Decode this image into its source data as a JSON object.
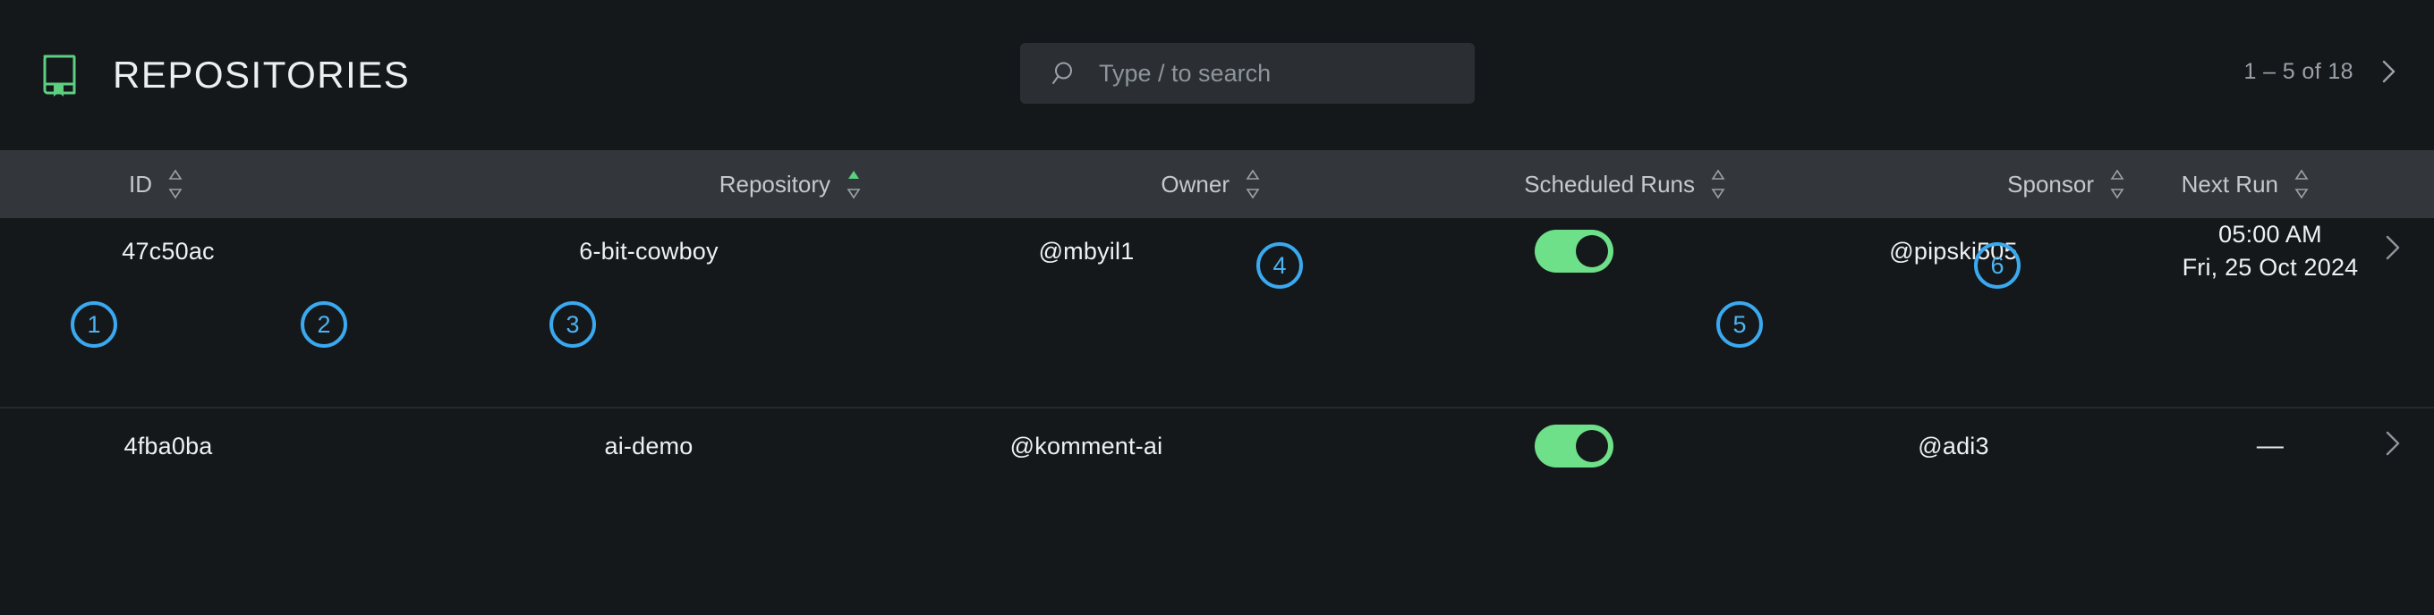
{
  "header": {
    "logo_icon": "repository-book-icon",
    "title": "REPOSITORIES",
    "accent_color": "#5ccf80"
  },
  "search": {
    "icon": "search-icon",
    "placeholder": "Type / to search",
    "value": ""
  },
  "pagination": {
    "range_label": "1 – 5 of 18",
    "next_icon": "chevron-right-icon"
  },
  "table": {
    "columns": [
      {
        "key": "id",
        "label": "ID",
        "sortable": true,
        "sort_state": "none"
      },
      {
        "key": "repository",
        "label": "Repository",
        "sortable": true,
        "sort_state": "asc"
      },
      {
        "key": "owner",
        "label": "Owner",
        "sortable": true,
        "sort_state": "none"
      },
      {
        "key": "runs",
        "label": "Scheduled Runs",
        "sortable": true,
        "sort_state": "none"
      },
      {
        "key": "sponsor",
        "label": "Sponsor",
        "sortable": true,
        "sort_state": "none"
      },
      {
        "key": "next_run",
        "label": "Next Run",
        "sortable": true,
        "sort_state": "none"
      }
    ],
    "rows": [
      {
        "id": "47c50ac",
        "repository": "6-bit-cowboy",
        "owner": "@mbyil1",
        "scheduled_runs_on": true,
        "sponsor": "@pipski505",
        "next_run_time": "05:00 AM",
        "next_run_date": "Fri, 25 Oct 2024",
        "open_icon": "chevron-right-icon"
      },
      {
        "id": "4fba0ba",
        "repository": "ai-demo",
        "owner": "@komment-ai",
        "scheduled_runs_on": true,
        "sponsor": "@adi3",
        "next_run_time": "—",
        "next_run_date": "",
        "open_icon": "chevron-right-icon"
      }
    ]
  },
  "annotations": {
    "color": "#3aa9f0",
    "markers": [
      {
        "number": "1",
        "target": "row-1-id"
      },
      {
        "number": "2",
        "target": "row-1-repository"
      },
      {
        "number": "3",
        "target": "row-1-owner"
      },
      {
        "number": "4",
        "target": "row-1-scheduled-runs-toggle"
      },
      {
        "number": "5",
        "target": "row-1-sponsor"
      },
      {
        "number": "6",
        "target": "row-1-next-run"
      }
    ]
  }
}
